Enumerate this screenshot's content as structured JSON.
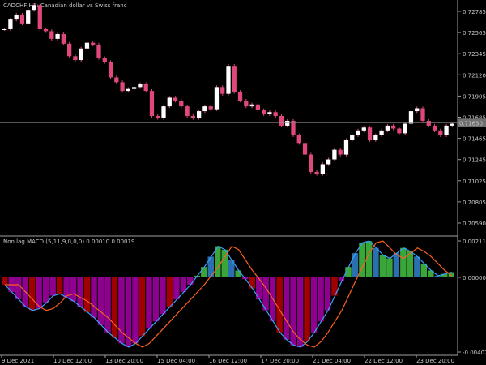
{
  "header": {
    "symbol_title": "CADCHF,H1:  Canadian dollar vs Swiss franc",
    "indicator_title": "Non lag MACD (5,11,9,0,0,0) 0.00010 0.00019"
  },
  "colors": {
    "background": "#000000",
    "separator": "#a0a0a0",
    "candle": "#ffffff",
    "candle_shadow": "#e0487a",
    "bull_hist": "#3aa63a",
    "bull_hist_dark": "#2a6fb0",
    "bear_hist": "#8e008e",
    "bear_hist_dark": "#a00000",
    "macd_line": "#3aa0ff",
    "signal_line": "#ff6020",
    "current_price_line": "#8a8a8a"
  },
  "price_axis": {
    "ticks": [
      "0.72805",
      "0.72585",
      "0.72365",
      "0.72145",
      "0.71925",
      "0.71705",
      "0.71485",
      "0.71265",
      "0.71045",
      "0.70825",
      "0.70605"
    ],
    "visible_ticks": [
      "0.72785",
      "0.72565",
      "0.72345",
      "0.72120",
      "0.71905",
      "0.71685",
      "0.71465",
      "0.71245",
      "0.71025",
      "0.70805",
      "0.70590"
    ],
    "current_price": "0.71630",
    "labels": [
      "0.72785",
      "0.72565",
      "0.72345",
      "0.72120",
      "0.71905",
      "0.71685",
      "0.71465",
      "0.71245",
      "0.71025",
      "0.70805",
      "0.70590"
    ]
  },
  "indicator_axis": {
    "labels": [
      "0.00211",
      "0.00000",
      "-0.00407"
    ]
  },
  "time_axis": {
    "labels": [
      "9 Dec 2021",
      "10 Dec 12:00",
      "13 Dec 20:00",
      "15 Dec 04:00",
      "16 Dec 12:00",
      "17 Dec 20:00",
      "21 Dec 04:00",
      "22 Dec 12:00",
      "23 Dec 20:00"
    ]
  },
  "chart_data": {
    "type": "line",
    "title": "CADCHF,H1:  Canadian dollar vs Swiss franc",
    "series": [
      {
        "name": "CADCHF close",
        "values": [
          0.726,
          0.727,
          0.7275,
          0.7266,
          0.728,
          0.7285,
          0.726,
          0.7258,
          0.725,
          0.7255,
          0.7245,
          0.7232,
          0.7228,
          0.724,
          0.7246,
          0.7244,
          0.723,
          0.7226,
          0.721,
          0.7205,
          0.7196,
          0.7198,
          0.72,
          0.7203,
          0.7196,
          0.717,
          0.7168,
          0.718,
          0.7189,
          0.7186,
          0.718,
          0.717,
          0.7168,
          0.7175,
          0.718,
          0.7177,
          0.72,
          0.7193,
          0.7222,
          0.7195,
          0.7186,
          0.718,
          0.7182,
          0.7176,
          0.7172,
          0.7174,
          0.717,
          0.716,
          0.7165,
          0.715,
          0.7142,
          0.713,
          0.7112,
          0.711,
          0.712,
          0.7125,
          0.7135,
          0.713,
          0.7145,
          0.715,
          0.7155,
          0.7158,
          0.7145,
          0.715,
          0.7155,
          0.716,
          0.7157,
          0.7152,
          0.7162,
          0.7175,
          0.7178,
          0.7165,
          0.716,
          0.7155,
          0.715,
          0.716,
          0.7162
        ]
      }
    ],
    "ylim": [
      0.7059,
      0.72785
    ]
  },
  "macd_data": {
    "histogram": [
      -0.0004,
      -0.0008,
      -0.0012,
      -0.0016,
      -0.0018,
      -0.0017,
      -0.0014,
      -0.001,
      -0.0009,
      -0.0011,
      -0.0013,
      -0.0016,
      -0.0019,
      -0.0022,
      -0.0026,
      -0.003,
      -0.0033,
      -0.0036,
      -0.0038,
      -0.0036,
      -0.0032,
      -0.0028,
      -0.0024,
      -0.002,
      -0.0016,
      -0.0012,
      -0.0008,
      -0.0004,
      0.0001,
      0.0006,
      0.0012,
      0.0018,
      0.0016,
      0.001,
      0.0004,
      -0.0001,
      -0.0006,
      -0.0012,
      -0.0018,
      -0.0024,
      -0.003,
      -0.0034,
      -0.0037,
      -0.0038,
      -0.0035,
      -0.003,
      -0.0024,
      -0.0018,
      -0.001,
      -0.0002,
      0.0006,
      0.0014,
      0.002,
      0.0021,
      0.0017,
      0.0013,
      0.0011,
      0.0014,
      0.0017,
      0.0015,
      0.0012,
      0.0008,
      0.0004,
      0.0001,
      0.0002,
      0.0003
    ]
  }
}
